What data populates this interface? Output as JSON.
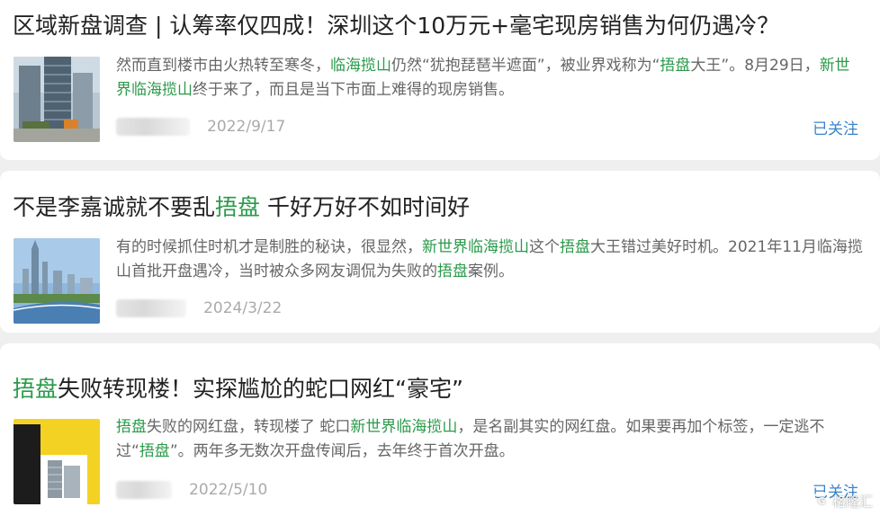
{
  "articles": [
    {
      "title": "区域新盘调查 | 认筹率仅四成！深圳这个10万元+毫宅现房销售为何仍遇冷？",
      "summary": [
        {
          "text": "然而直到楼市由火热转至寒冬，"
        },
        {
          "text": "临海揽山",
          "hl": true
        },
        {
          "text": "仍然“犹抱琵琶半遮面”，被业界戏称为“"
        },
        {
          "text": "捂盘",
          "hl": true
        },
        {
          "text": "大王”。8月29日，"
        },
        {
          "text": "新世界临海揽山",
          "hl": true
        },
        {
          "text": "终于来了，而且是当下市面上难得的现房销售。"
        }
      ],
      "date": "2022/9/17",
      "follow_label": "已关注"
    },
    {
      "title_parts": [
        {
          "text": "不是李嘉诚就不要乱"
        },
        {
          "text": "捂盘",
          "hl": true
        },
        {
          "text": " 千好万好不如时间好"
        }
      ],
      "summary": [
        {
          "text": "有的时候抓住时机才是制胜的秘诀，很显然，"
        },
        {
          "text": "新世界临海揽山",
          "hl": true
        },
        {
          "text": "这个"
        },
        {
          "text": "捂盘",
          "hl": true
        },
        {
          "text": "大王错过美好时机。2021年11月临海揽山首批开盘遇冷，当时被众多网友调侃为失败的"
        },
        {
          "text": "捂盘",
          "hl": true
        },
        {
          "text": "案例。"
        }
      ],
      "date": "2024/3/22"
    },
    {
      "title_parts": [
        {
          "text": "捂盘",
          "hl": true
        },
        {
          "text": "失败转现楼！实探尴尬的蛇口网红“豪宅”"
        }
      ],
      "summary": [
        {
          "text": "捂盘",
          "hl": true
        },
        {
          "text": "失败的网红盘，转现楼了 蛇口"
        },
        {
          "text": "新世界临海揽山",
          "hl": true
        },
        {
          "text": "，是名副其实的网红盘。如果要再加个标签，一定逃不过“"
        },
        {
          "text": "捂盘",
          "hl": true
        },
        {
          "text": "”。两年多无数次开盘传闻后，去年终于首次开盘。"
        }
      ],
      "date": "2022/5/10",
      "follow_label": "已关注"
    }
  ],
  "watermark": {
    "logo": "G",
    "text": "格隆汇"
  },
  "colors": {
    "highlight": "#2a9a4a",
    "follow": "#3a83c9",
    "date": "#aaaaaa",
    "background": "#efefef"
  }
}
